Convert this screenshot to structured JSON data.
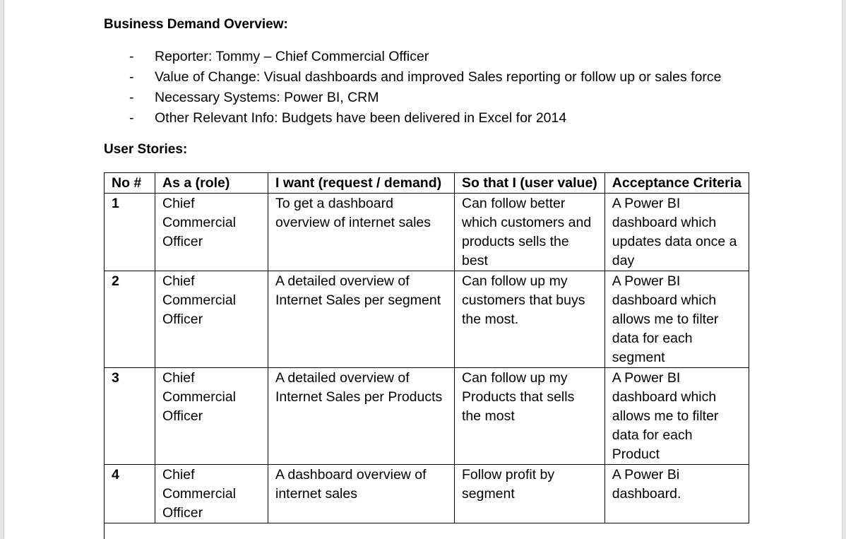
{
  "sections": {
    "overview_title": "Business Demand Overview:",
    "user_stories_title": "User Stories:"
  },
  "bullets": [
    {
      "dash": "-",
      "text": "Reporter: Tommy – Chief Commercial Officer"
    },
    {
      "dash": "-",
      "text": "Value of Change: Visual dashboards and improved Sales reporting or follow up or sales force"
    },
    {
      "dash": "-",
      "text": "Necessary Systems: Power BI, CRM"
    },
    {
      "dash": "-",
      "text": "Other Relevant Info: Budgets have been delivered in Excel for 2014"
    }
  ],
  "table": {
    "headers": [
      "No #",
      "As a (role)",
      "I want (request / demand)",
      "So that I (user value)",
      "Acceptance Criteria"
    ],
    "rows": [
      [
        "1",
        "Chief Commercial Officer",
        "To get a dashboard overview of internet sales",
        "Can follow better which customers and products sells the best",
        "A Power BI dashboard which updates data once a day"
      ],
      [
        "2",
        "Chief Commercial Officer",
        "A detailed overview of Internet Sales per segment",
        "Can follow up my customers that buys the most.",
        "A Power BI dashboard which allows me to filter data for each segment"
      ],
      [
        "3",
        "Chief Commercial Officer",
        "A detailed overview of Internet Sales per Products",
        "Can follow up my Products that sells the most",
        "A Power BI dashboard which allows me to filter data for each Product"
      ],
      [
        "4",
        "Chief Commercial Officer",
        "A dashboard overview of internet sales",
        "Follow profit by segment",
        "A Power Bi dashboard."
      ]
    ]
  }
}
